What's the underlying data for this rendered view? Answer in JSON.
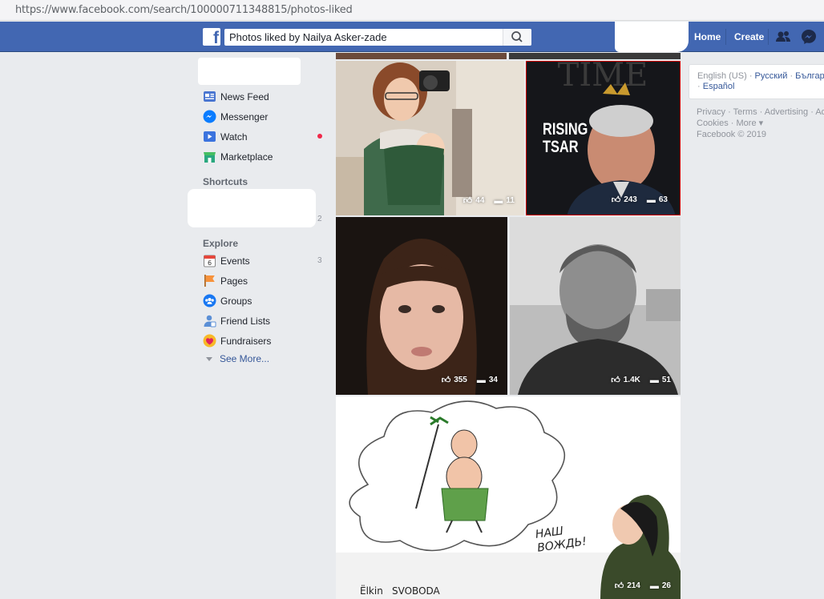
{
  "browser": {
    "url": "https://www.facebook.com/search/100000711348815/photos-liked"
  },
  "header": {
    "search_value": "Photos liked by Nailya Asker-zade",
    "home_label": "Home",
    "create_label": "Create",
    "brand_color": "#4267b2"
  },
  "sidebar": {
    "items": [
      {
        "label": "News Feed",
        "icon": "news-feed-icon"
      },
      {
        "label": "Messenger",
        "icon": "messenger-icon"
      },
      {
        "label": "Watch",
        "icon": "watch-icon"
      },
      {
        "label": "Marketplace",
        "icon": "marketplace-icon"
      }
    ],
    "shortcuts_title": "Shortcuts",
    "shortcuts_count": "2",
    "explore_title": "Explore",
    "explore": [
      {
        "label": "Events",
        "count": "3",
        "icon": "events-icon"
      },
      {
        "label": "Pages",
        "icon": "pages-icon"
      },
      {
        "label": "Groups",
        "icon": "groups-icon"
      },
      {
        "label": "Friend Lists",
        "icon": "friend-lists-icon"
      },
      {
        "label": "Fundraisers",
        "icon": "fundraisers-icon"
      }
    ],
    "see_more": "See More..."
  },
  "photos": [
    {
      "likes": "44",
      "comments": "11"
    },
    {
      "likes": "243",
      "comments": "63",
      "cover_text": "RISING TSAR"
    },
    {
      "likes": "355",
      "comments": "34"
    },
    {
      "likes": "1.4K",
      "comments": "51"
    },
    {
      "likes": "214",
      "comments": "26",
      "cartoon_text": "НАШ ВОЖДЬ!"
    }
  ],
  "right": {
    "lang_current": "English (US)",
    "lang_options": [
      "Русский",
      "Български",
      "Español"
    ],
    "footer_line1": "Privacy · Terms · Advertising · Ad Choices",
    "footer_line2": "Cookies · More ▾",
    "copyright": "Facebook © 2019"
  }
}
